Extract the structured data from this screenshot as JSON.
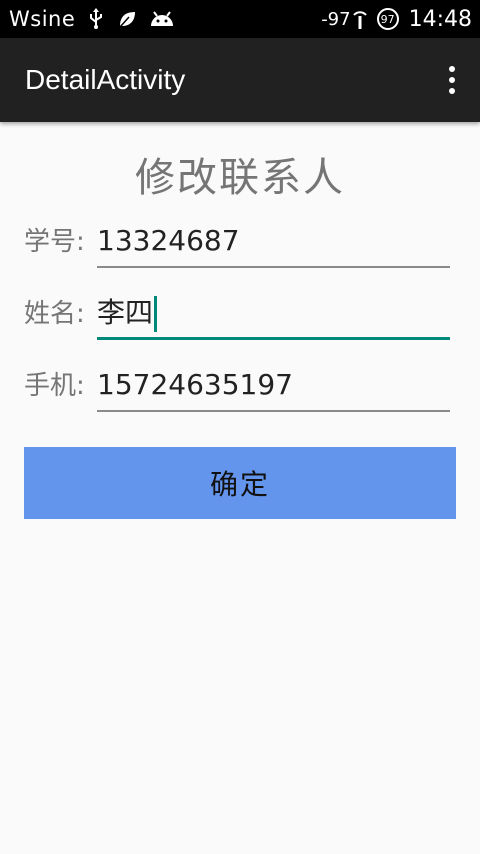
{
  "status_bar": {
    "carrier": "Wsine",
    "signal": "-97",
    "battery": "97",
    "time": "14:48",
    "icons": [
      "usb-icon",
      "leaf-icon",
      "android-icon",
      "wifi-icon",
      "battery-icon"
    ]
  },
  "app_bar": {
    "title": "DetailActivity",
    "overflow_icon": "overflow-menu-icon"
  },
  "form": {
    "title": "修改联系人",
    "fields": [
      {
        "label": "学号:",
        "value": "13324687",
        "focused": false
      },
      {
        "label": "姓名:",
        "value": "李四",
        "focused": true
      },
      {
        "label": "手机:",
        "value": "15724635197",
        "focused": false
      }
    ],
    "confirm_label": "确定"
  },
  "colors": {
    "status_bar": "#000000",
    "app_bar": "#212121",
    "background": "#fafafa",
    "accent": "#00897b",
    "button": "#6495ed"
  }
}
